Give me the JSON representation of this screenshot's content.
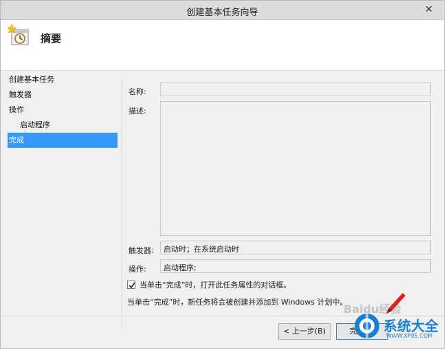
{
  "window": {
    "title": "创建基本任务向导",
    "close_glyph": "✕"
  },
  "header": {
    "title": "摘要",
    "icon": "scheduled-task-clock-icon"
  },
  "nav": {
    "items": [
      {
        "label": "创建基本任务",
        "indent": false,
        "active": false
      },
      {
        "label": "触发器",
        "indent": false,
        "active": false
      },
      {
        "label": "操作",
        "indent": false,
        "active": false
      },
      {
        "label": "启动程序",
        "indent": true,
        "active": false
      },
      {
        "label": "完成",
        "indent": false,
        "active": true
      }
    ]
  },
  "form": {
    "name_label": "名称:",
    "name_value": "",
    "description_label": "描述:",
    "description_value": "",
    "trigger_label": "触发器:",
    "trigger_value": "启动时；在系统启动时",
    "action_label": "操作:",
    "action_value": "启动程序;"
  },
  "options": {
    "open_properties_checked": true,
    "open_properties_label": "当单击“完成”时，打开此任务属性的对话框。",
    "info_text": "当单击“完成”时，新任务将会被创建并添加到 Windows 计划中。"
  },
  "buttons": {
    "back_label": "< 上一步(B)",
    "finish_label": "完成(F)"
  },
  "watermark": {
    "site_text": "系统大全",
    "url_text": "WWW.XP85.COM",
    "baidu_text": "Baidu经验"
  },
  "colors": {
    "selection": "#3399ff",
    "watermark_blue": "#1a7fd0",
    "pen_red": "#e02020"
  }
}
